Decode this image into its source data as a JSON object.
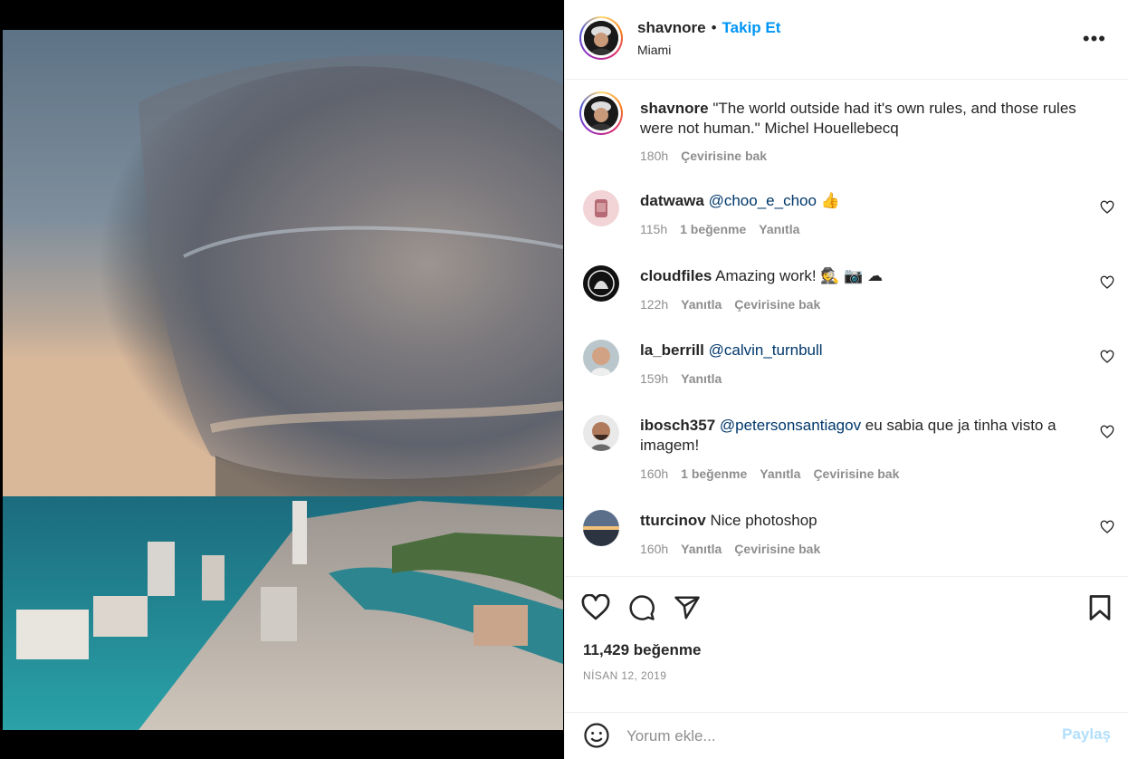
{
  "post": {
    "username": "shavnore",
    "separator": "•",
    "follow_label": "Takip Et",
    "location": "Miami",
    "more_label": "•••",
    "caption": {
      "username": "shavnore",
      "text": "\"The world outside had it's own rules, and those rules were not human.\" Michel Houellebecq",
      "time": "180h",
      "translate": "Çevirisine bak"
    },
    "comments": [
      {
        "username": "datwawa",
        "mention": "@choo_e_choo",
        "text": " 👍",
        "time": "115h",
        "likes": "1 beğenme",
        "reply": "Yanıtla",
        "translate": ""
      },
      {
        "username": "cloudfiles",
        "mention": "",
        "text": "Amazing work! 🕵 📷 ☁",
        "time": "122h",
        "likes": "",
        "reply": "Yanıtla",
        "translate": "Çevirisine bak"
      },
      {
        "username": "la_berrill",
        "mention": "@calvin_turnbull",
        "text": "",
        "time": "159h",
        "likes": "",
        "reply": "Yanıtla",
        "translate": ""
      },
      {
        "username": "ibosch357",
        "mention": "@petersonsantiagov",
        "text": " eu sabia que ja tinha visto a imagem!",
        "time": "160h",
        "likes": "1 beğenme",
        "reply": "Yanıtla",
        "translate": "Çevirisine bak"
      },
      {
        "username": "tturcinov",
        "mention": "",
        "text": "Nice photoshop",
        "time": "160h",
        "likes": "",
        "reply": "Yanıtla",
        "translate": "Çevirisine bak"
      }
    ],
    "like_count": "11,429 beğenme",
    "date": "NİSAN 12, 2019",
    "comment_placeholder": "Yorum ekle...",
    "post_button": "Paylaş"
  },
  "colors": {
    "accent": "#0095f6",
    "text": "#262626",
    "muted": "#8e8e8e",
    "mention": "#00376b"
  },
  "icons": [
    "heart-icon",
    "comment-icon",
    "share-icon",
    "bookmark-icon",
    "emoji-icon",
    "more-icon"
  ]
}
